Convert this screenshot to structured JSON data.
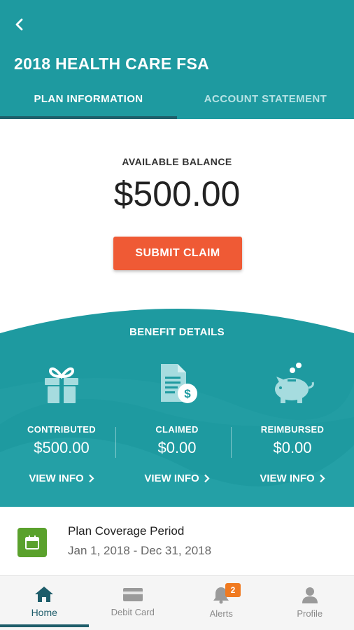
{
  "header": {
    "title": "2018 HEALTH CARE FSA",
    "tabs": [
      {
        "label": "PLAN INFORMATION",
        "active": true
      },
      {
        "label": "ACCOUNT STATEMENT",
        "active": false
      }
    ]
  },
  "balance": {
    "label": "AVAILABLE BALANCE",
    "value": "$500.00",
    "submit_label": "SUBMIT CLAIM"
  },
  "benefit": {
    "title": "BENEFIT DETAILS",
    "columns": [
      {
        "icon": "gift-icon",
        "label": "CONTRIBUTED",
        "value": "$500.00",
        "link": "VIEW INFO"
      },
      {
        "icon": "claim-document-icon",
        "label": "CLAIMED",
        "value": "$0.00",
        "link": "VIEW INFO"
      },
      {
        "icon": "piggy-bank-icon",
        "label": "REIMBURSED",
        "value": "$0.00",
        "link": "VIEW INFO"
      }
    ]
  },
  "coverage": {
    "title": "Plan Coverage Period",
    "dates": "Jan 1, 2018 - Dec 31, 2018"
  },
  "nav": {
    "items": [
      {
        "label": "Home",
        "icon": "home-icon",
        "active": true
      },
      {
        "label": "Debit Card",
        "icon": "card-icon",
        "active": false
      },
      {
        "label": "Alerts",
        "icon": "bell-icon",
        "active": false,
        "badge": "2"
      },
      {
        "label": "Profile",
        "icon": "user-icon",
        "active": false
      }
    ]
  },
  "colors": {
    "primary": "#1e9aa0",
    "accent": "#ef5a35",
    "nav_active": "#1e5d6a",
    "calendar": "#5aa12c",
    "badge": "#f07a20"
  }
}
